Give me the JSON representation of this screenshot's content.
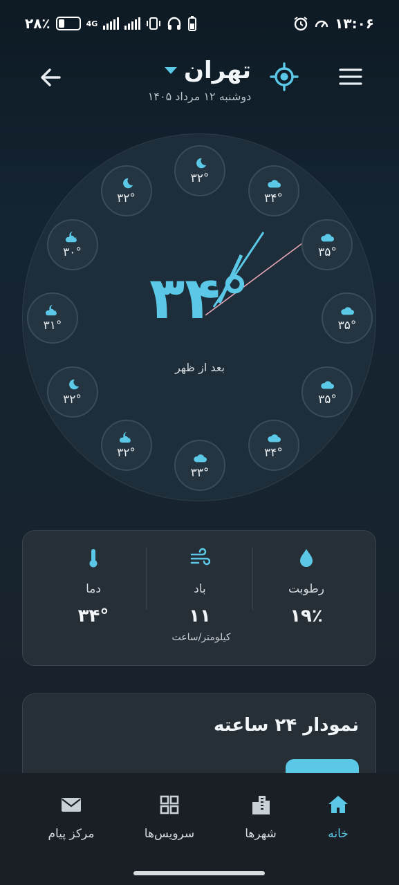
{
  "status_bar": {
    "battery_text": "۲۸٪",
    "network": "4G",
    "time": "۱۳:۰۶"
  },
  "header": {
    "city": "تهران",
    "date": "دوشنبه ۱۲ مرداد ۱۴۰۵",
    "icons": [
      "back-arrow-icon",
      "locate-icon",
      "menu-icon",
      "dropdown-icon"
    ]
  },
  "clock": {
    "current_temp": "۳۴°",
    "period": "بعد از ظهر",
    "hours": [
      {
        "temp": "۳۲°",
        "icon": "moon-icon"
      },
      {
        "temp": "۳۴°",
        "icon": "cloud-icon"
      },
      {
        "temp": "۳۵°",
        "icon": "cloud-icon"
      },
      {
        "temp": "۳۵°",
        "icon": "cloud-icon"
      },
      {
        "temp": "۳۵°",
        "icon": "cloud-icon"
      },
      {
        "temp": "۳۴°",
        "icon": "cloud-icon"
      },
      {
        "temp": "۳۳°",
        "icon": "cloud-icon"
      },
      {
        "temp": "۳۲°",
        "icon": "moon-cloud-icon"
      },
      {
        "temp": "۳۲°",
        "icon": "moon-icon"
      },
      {
        "temp": "۳۱°",
        "icon": "moon-cloud-icon"
      },
      {
        "temp": "۳۰°",
        "icon": "moon-cloud-icon"
      },
      {
        "temp": "۳۲°",
        "icon": "moon-icon"
      }
    ]
  },
  "metrics": {
    "humidity": {
      "label": "رطوبت",
      "value": "۱۹٪",
      "icon": "droplet-icon"
    },
    "wind": {
      "label": "باد",
      "value": "۱۱",
      "unit": "کیلومتر/ساعت",
      "icon": "wind-icon"
    },
    "temp": {
      "label": "دما",
      "value": "۳۴°",
      "icon": "thermometer-icon"
    }
  },
  "chart_card": {
    "title": "نمودار ۲۴ ساعته"
  },
  "nav": {
    "home": "خانه",
    "cities": "شهرها",
    "services": "سرویس‌ها",
    "messages": "مرکز پیام"
  },
  "colors": {
    "accent": "#5ac8e6",
    "background": "#142431",
    "card": "#262e36"
  }
}
